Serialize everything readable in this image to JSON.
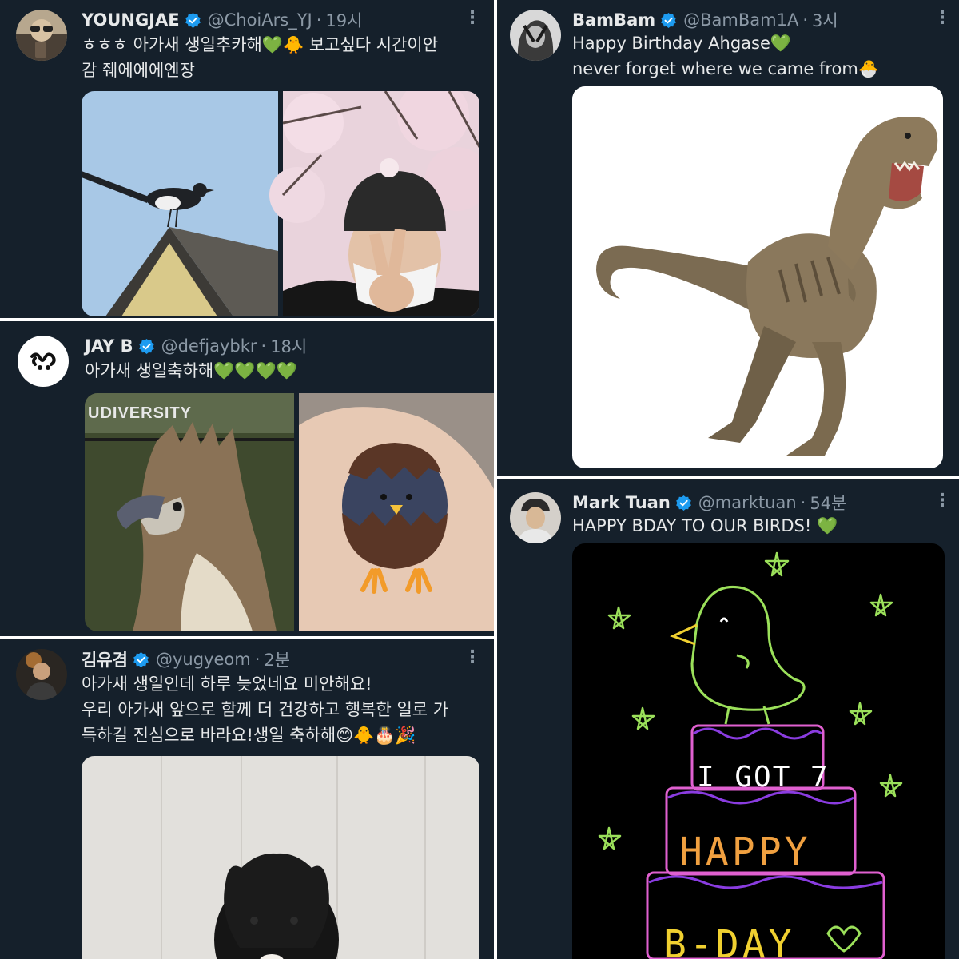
{
  "tweets": [
    {
      "name": "YOUNGJAE",
      "handle": "@ChoiArs_YJ",
      "time": "19시",
      "lines": [
        "ㅎㅎㅎ 아가새 생일추카해💚🐥 보고싶다 시간이안",
        "감 줴에에에엔장"
      ],
      "media": [
        "magpie-photo",
        "cherry-blossom-selfie-photo"
      ]
    },
    {
      "name": "JAY B",
      "handle": "@defjaybkr",
      "time": "18시",
      "lines": [
        "아가새 생일축하해💚💚💚💚"
      ],
      "media_caption": "UDIVERSITY",
      "media": [
        "eagle-photo",
        "chick-egg-figure-photo"
      ]
    },
    {
      "name": "김유겸",
      "handle": "@yugyeom",
      "time": "2분",
      "lines": [
        "아가새 생일인데 하루 늦었네요 미안해요!",
        "우리 아가새 앞으로 함께 더 건강하고 행복한 일로 가",
        "득하길 진심으로 바라요!생일 축하해😊🐥🎂🎉"
      ],
      "media": [
        "black-dog-photo"
      ]
    },
    {
      "name": "BamBam",
      "handle": "@BamBam1A",
      "time": "3시",
      "lines": [
        "Happy Birthday Ahgase💚",
        "never forget where we came from🐣"
      ],
      "media": [
        "t-rex-image"
      ]
    },
    {
      "name": "Mark Tuan",
      "handle": "@marktuan",
      "time": "54분",
      "lines": [
        "HAPPY BDAY TO OUR BIRDS! 💚"
      ],
      "drawing": {
        "line1": "I GOT 7",
        "line2": "HAPPY",
        "line3": "B-DAY"
      },
      "media": [
        "bird-cake-drawing"
      ]
    }
  ],
  "colors": {
    "background": "#15202b",
    "text": "#e7e9ea",
    "muted": "#8b98a5",
    "verified": "#1d9bf0"
  },
  "icons": [
    "verified-badge-icon",
    "more-options-icon"
  ]
}
